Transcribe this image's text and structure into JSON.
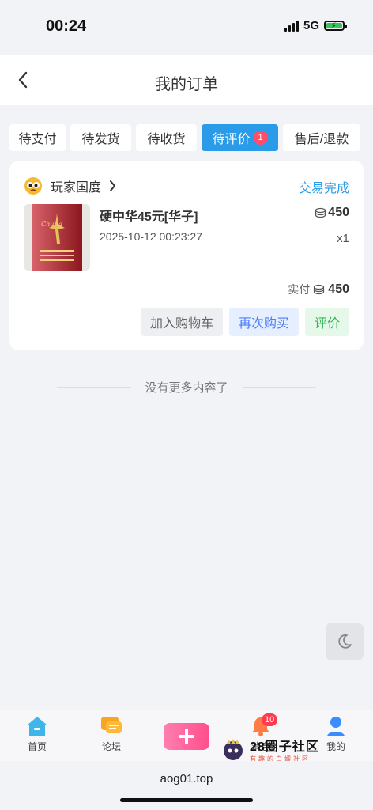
{
  "status_bar": {
    "time": "00:24",
    "network": "5G"
  },
  "header": {
    "title": "我的订单"
  },
  "tabs": [
    {
      "label": "待支付"
    },
    {
      "label": "待发货"
    },
    {
      "label": "待收货"
    },
    {
      "label": "待评价",
      "badge": "1",
      "active": true
    },
    {
      "label": "售后/退款"
    }
  ],
  "order": {
    "shop_name": "玩家国度",
    "status": "交易完成",
    "product_name": "硬中华45元[华子]",
    "time": "2025-10-12 00:23:27",
    "price": "450",
    "quantity": "x1",
    "paid_label": "实付",
    "paid_amount": "450",
    "buttons": {
      "cart": "加入购物车",
      "rebuy": "再次购买",
      "review": "评价"
    }
  },
  "list_end_text": "没有更多内容了",
  "bottom_nav": {
    "home": "首页",
    "forum": "论坛",
    "notify": "消息",
    "notify_badge": "10",
    "mine": "我的"
  },
  "watermark": {
    "title": "28圈子社区",
    "subtitle": "有趣的白嫖社区"
  },
  "url": "aog01.top",
  "colors": {
    "accent": "#2a9be8",
    "badge": "#ff4d6a",
    "success": "#2fb650"
  }
}
